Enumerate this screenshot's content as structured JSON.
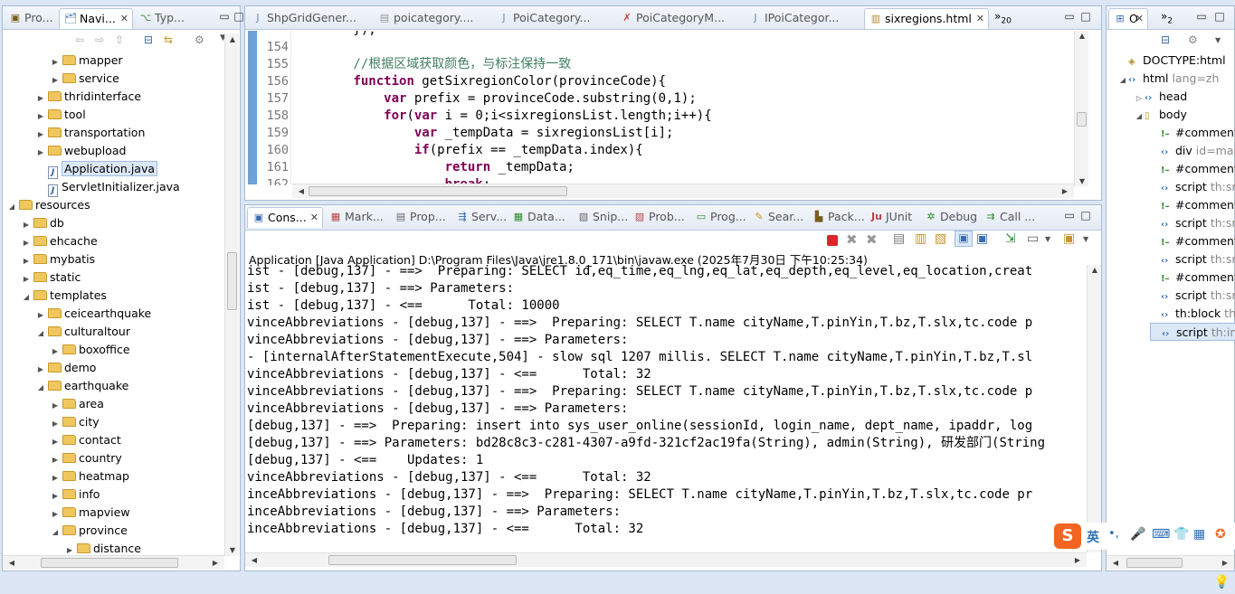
{
  "left_panel": {
    "tabs": [
      "Pro...",
      "Navi...",
      "Typ..."
    ],
    "tree": [
      {
        "label": "mapper",
        "indent": 3,
        "type": "folder",
        "expand": "▶"
      },
      {
        "label": "service",
        "indent": 3,
        "type": "folder",
        "expand": "▶"
      },
      {
        "label": "thridinterface",
        "indent": 2,
        "type": "folder",
        "expand": "▶"
      },
      {
        "label": "tool",
        "indent": 2,
        "type": "folder",
        "expand": "▶"
      },
      {
        "label": "transportation",
        "indent": 2,
        "type": "folder",
        "expand": "▶"
      },
      {
        "label": "webupload",
        "indent": 2,
        "type": "folder",
        "expand": "▶"
      },
      {
        "label": "Application.java",
        "indent": 2,
        "type": "java",
        "expand": "",
        "selected": true
      },
      {
        "label": "ServletInitializer.java",
        "indent": 2,
        "type": "java",
        "expand": ""
      },
      {
        "label": "resources",
        "indent": 0,
        "type": "folder",
        "expand": "◢"
      },
      {
        "label": "db",
        "indent": 1,
        "type": "folder",
        "expand": "▶"
      },
      {
        "label": "ehcache",
        "indent": 1,
        "type": "folder",
        "expand": "▶"
      },
      {
        "label": "mybatis",
        "indent": 1,
        "type": "folder",
        "expand": "▶"
      },
      {
        "label": "static",
        "indent": 1,
        "type": "folder",
        "expand": "▶"
      },
      {
        "label": "templates",
        "indent": 1,
        "type": "folder",
        "expand": "◢"
      },
      {
        "label": "ceicearthquake",
        "indent": 2,
        "type": "folder",
        "expand": "▶"
      },
      {
        "label": "culturaltour",
        "indent": 2,
        "type": "folder",
        "expand": "◢"
      },
      {
        "label": "boxoffice",
        "indent": 3,
        "type": "folder",
        "expand": "▶"
      },
      {
        "label": "demo",
        "indent": 2,
        "type": "folder",
        "expand": "▶"
      },
      {
        "label": "earthquake",
        "indent": 2,
        "type": "folder",
        "expand": "◢"
      },
      {
        "label": "area",
        "indent": 3,
        "type": "folder",
        "expand": "▶"
      },
      {
        "label": "city",
        "indent": 3,
        "type": "folder",
        "expand": "▶"
      },
      {
        "label": "contact",
        "indent": 3,
        "type": "folder",
        "expand": "▶"
      },
      {
        "label": "country",
        "indent": 3,
        "type": "folder",
        "expand": "▶"
      },
      {
        "label": "heatmap",
        "indent": 3,
        "type": "folder",
        "expand": "▶"
      },
      {
        "label": "info",
        "indent": 3,
        "type": "folder",
        "expand": "▶"
      },
      {
        "label": "mapview",
        "indent": 3,
        "type": "folder",
        "expand": "▶"
      },
      {
        "label": "province",
        "indent": 3,
        "type": "folder",
        "expand": "◢"
      },
      {
        "label": "distance",
        "indent": 4,
        "type": "folder",
        "expand": "▶"
      }
    ]
  },
  "editor": {
    "tabs": [
      "ShpGridGener...",
      "poicategory....",
      "PoiCategory...",
      "PoiCategoryM...",
      "IPoiCategor...",
      "sixregions.html"
    ],
    "overflow_count": "20",
    "active_tab": "sixregions.html",
    "partial_top_line": "        });",
    "lines": [
      {
        "num": "154",
        "text": ""
      },
      {
        "num": "155",
        "text": "        //根据区域获取颜色，与标注保持一致"
      },
      {
        "num": "156",
        "text": "        function getSixregionColor(provinceCode){"
      },
      {
        "num": "157",
        "text": "            var prefix = provinceCode.substring(0,1);"
      },
      {
        "num": "158",
        "text": "            for(var i = 0;i<sixregionsList.length;i++){"
      },
      {
        "num": "159",
        "text": "                var _tempData = sixregionsList[i];"
      },
      {
        "num": "160",
        "text": "                if(prefix == _tempData.index){"
      },
      {
        "num": "161",
        "text": "                    return _tempData;"
      },
      {
        "num": "162",
        "text": "                    break;"
      }
    ]
  },
  "console": {
    "tabs": [
      "Cons...",
      "Mark...",
      "Prop...",
      "Serv...",
      "Data...",
      "Snip...",
      "Prob...",
      "Prog...",
      "Sear...",
      "Pack...",
      "JUnit",
      "Debug",
      "Call ..."
    ],
    "header": "Application [Java Application] D:\\Program Files\\Java\\jre1.8.0_171\\bin\\javaw.exe (2025年7月30日 下午10:25:34)",
    "lines": [
      "ist - [debug,137] - ==>  Preparing: SELECT id,eq_time,eq_lng,eq_lat,eq_depth,eq_level,eq_location,creat",
      "ist - [debug,137] - ==> Parameters: ",
      "ist - [debug,137] - <==      Total: 10000",
      "vinceAbbreviations - [debug,137] - ==>  Preparing: SELECT T.name cityName,T.pinYin,T.bz,T.slx,tc.code p",
      "vinceAbbreviations - [debug,137] - ==> Parameters: ",
      "- [internalAfterStatementExecute,504] - slow sql 1207 millis. SELECT T.name cityName,T.pinYin,T.bz,T.sl",
      "vinceAbbreviations - [debug,137] - <==      Total: 32",
      "vinceAbbreviations - [debug,137] - ==>  Preparing: SELECT T.name cityName,T.pinYin,T.bz,T.slx,tc.code p",
      "vinceAbbreviations - [debug,137] - ==> Parameters: ",
      "[debug,137] - ==>  Preparing: insert into sys_user_online(sessionId, login_name, dept_name, ipaddr, log",
      "[debug,137] - ==> Parameters: bd28c8c3-c281-4307-a9fd-321cf2ac19fa(String), admin(String), 研发部门(String",
      "[debug,137] - <==    Updates: 1",
      "vinceAbbreviations - [debug,137] - <==      Total: 32",
      "inceAbbreviations - [debug,137] - ==>  Preparing: SELECT T.name cityName,T.pinYin,T.bz,T.slx,tc.code pr",
      "inceAbbreviations - [debug,137] - ==> Parameters: ",
      "inceAbbreviations - [debug,137] - <==      Total: 32"
    ]
  },
  "outline": {
    "tab": "O",
    "overflow_count": "2",
    "rows": [
      {
        "label": "DOCTYPE:html",
        "attr": "",
        "indent": 0,
        "kind": "doctype",
        "expand": ""
      },
      {
        "label": "html",
        "attr": " lang=zh",
        "indent": 0,
        "kind": "tag",
        "expand": "◢"
      },
      {
        "label": "head",
        "attr": "",
        "indent": 1,
        "kind": "tag",
        "expand": "▷"
      },
      {
        "label": "body",
        "attr": "",
        "indent": 1,
        "kind": "body",
        "expand": "◢"
      },
      {
        "label": "#comment",
        "attr": "",
        "indent": 2,
        "kind": "comment",
        "expand": ""
      },
      {
        "label": "div",
        "attr": " id=map",
        "indent": 2,
        "kind": "tag",
        "expand": ""
      },
      {
        "label": "#comment",
        "attr": "",
        "indent": 2,
        "kind": "comment",
        "expand": ""
      },
      {
        "label": "script",
        "attr": " th:src",
        "indent": 2,
        "kind": "tag",
        "expand": ""
      },
      {
        "label": "#comment",
        "attr": "",
        "indent": 2,
        "kind": "comment",
        "expand": ""
      },
      {
        "label": "script",
        "attr": " th:src",
        "indent": 2,
        "kind": "tag",
        "expand": ""
      },
      {
        "label": "#comment",
        "attr": "",
        "indent": 2,
        "kind": "comment",
        "expand": ""
      },
      {
        "label": "script",
        "attr": " th:src",
        "indent": 2,
        "kind": "tag",
        "expand": ""
      },
      {
        "label": "#comment",
        "attr": "",
        "indent": 2,
        "kind": "comment",
        "expand": ""
      },
      {
        "label": "script",
        "attr": " th:src",
        "indent": 2,
        "kind": "tag",
        "expand": ""
      },
      {
        "label": "th:block",
        "attr": " th:ir",
        "indent": 2,
        "kind": "tag",
        "expand": ""
      },
      {
        "label": "script",
        "attr": " th:inli",
        "indent": 2,
        "kind": "tag",
        "expand": "",
        "selected": true
      }
    ]
  },
  "ime": {
    "lang": "英",
    "punct": "•,"
  }
}
